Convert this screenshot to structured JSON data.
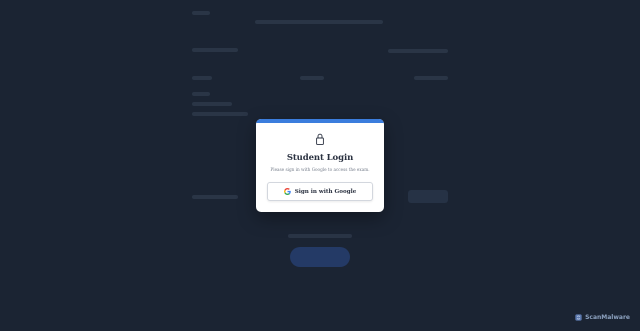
{
  "modal": {
    "title": "Student Login",
    "subtitle": "Please sign in with Google to access the exam.",
    "google_button_label": "Sign in with Google",
    "accent_color": "#3b7ddd"
  },
  "watermark": {
    "text": "ScanMalware"
  },
  "colors": {
    "overlay": "#1b2433",
    "modal_bg": "#ffffff",
    "text": "#2a3140"
  },
  "icons": {
    "lock": "lock-icon",
    "google": "google-icon",
    "watermark": "scanmalware-logo-icon"
  }
}
